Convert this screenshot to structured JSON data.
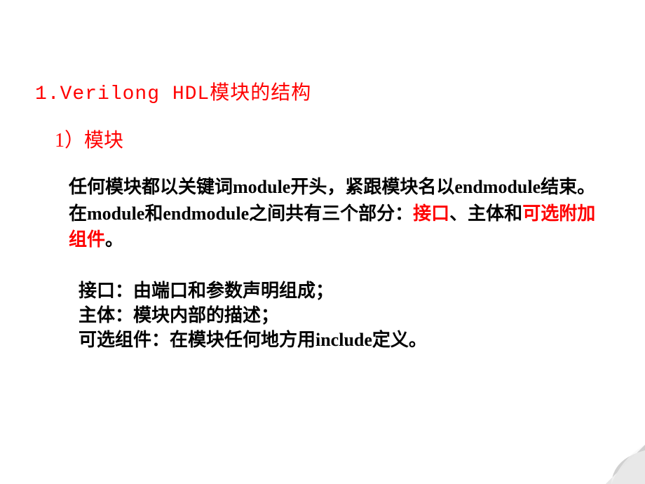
{
  "heading1": "1.Verilong HDL模块的结构",
  "heading2": "1）模块",
  "para1_part1": "任何模块都以关键词module开头，紧跟模块名以endmodule结束。在module和endmodule之间共有三个部分：",
  "para1_hl1": "接口",
  "para1_part2": "、主体和",
  "para1_hl2": "可选附加组件",
  "para1_part3": "。",
  "def1": "接口：由端口和参数声明组成；",
  "def2": "主体：模块内部的描述；",
  "def3": "可选组件：在模块任何地方用include定义。"
}
